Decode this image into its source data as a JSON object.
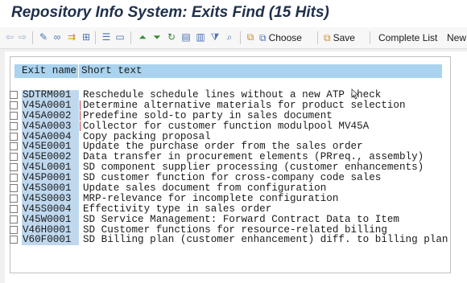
{
  "window": {
    "title": "Repository Info System: Exits Find (15 Hits)"
  },
  "toolbar": {
    "icons": [
      "back-arrow-icon",
      "forward-arrow-icon",
      "edit-pencil-icon",
      "where-used-icon",
      "transport-icon",
      "hierarchy-icon",
      "list-icon",
      "window-icon",
      "sort-ascending-icon",
      "sort-descending-icon",
      "refresh-icon",
      "export-icon",
      "export2-icon",
      "filter-icon",
      "find-icon",
      "copy-icon"
    ],
    "choose_label": "Choose",
    "save_label": "Save",
    "complete_list_label": "Complete List",
    "new_label": "New"
  },
  "list": {
    "columns": {
      "exit_name": "Exit name",
      "short_text": "Short text"
    },
    "rows": [
      {
        "name": "SDTRM001",
        "text": "Reschedule schedule lines without a new ATP check"
      },
      {
        "name": "V45A0001",
        "text": "Determine alternative materials for product selection"
      },
      {
        "name": "V45A0002",
        "text": "Predefine sold-to party in sales document"
      },
      {
        "name": "V45A0003",
        "text": "Collector for customer function modulpool MV45A"
      },
      {
        "name": "V45A0004",
        "text": "Copy packing proposal"
      },
      {
        "name": "V45E0001",
        "text": "Update the purchase order from the sales order"
      },
      {
        "name": "V45E0002",
        "text": "Data transfer in procurement elements (PRreq., assembly)"
      },
      {
        "name": "V45L0001",
        "text": "SD component supplier processing (customer enhancements)"
      },
      {
        "name": "V45P0001",
        "text": "SD customer function for cross-company code sales"
      },
      {
        "name": "V45S0001",
        "text": "Update sales document from configuration"
      },
      {
        "name": "V45S0003",
        "text": "MRP-relevance for incomplete configuration"
      },
      {
        "name": "V45S0004",
        "text": "Effectivity type in sales order"
      },
      {
        "name": "V45W0001",
        "text": "SD Service Management: Forward Contract Data to Item"
      },
      {
        "name": "V46H0001",
        "text": "SD Customer functions for resource-related billing"
      },
      {
        "name": "V60F0001",
        "text": "SD Billing plan (customer enhancement) diff. to billing plan"
      }
    ]
  }
}
